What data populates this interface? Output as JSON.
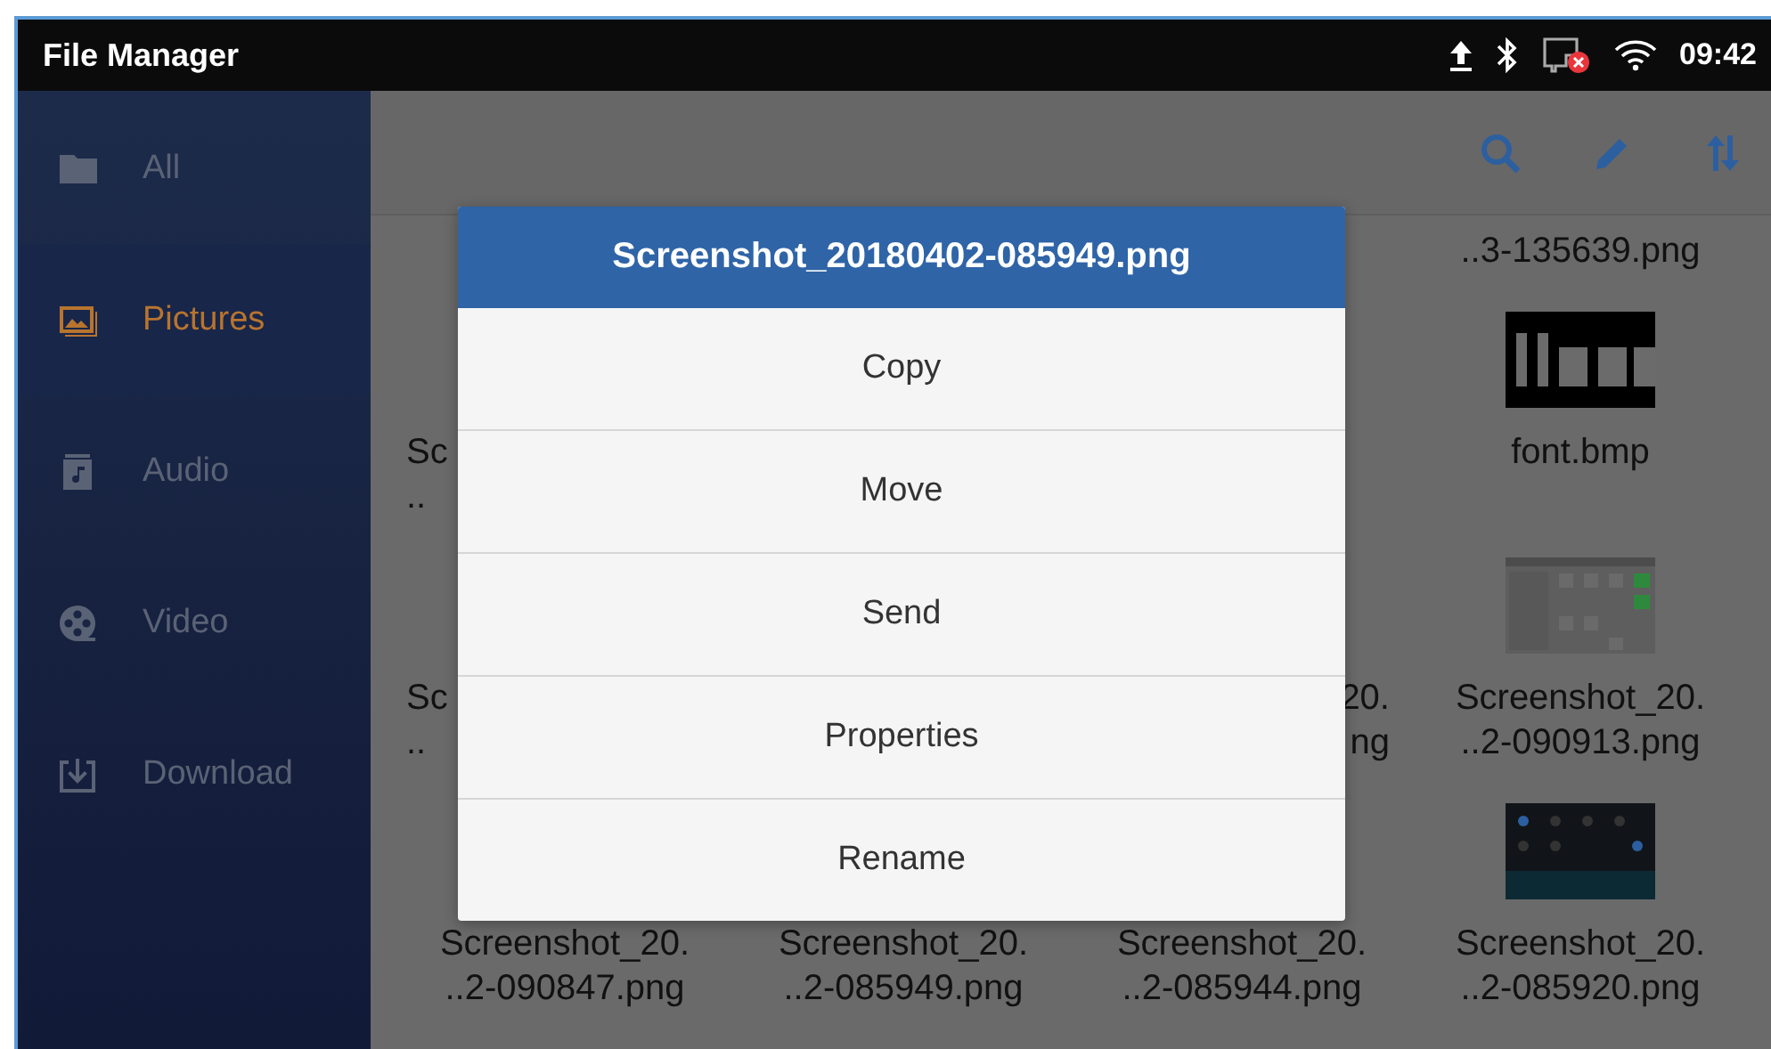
{
  "status_bar": {
    "title": "File Manager",
    "time": "09:42"
  },
  "sidebar": {
    "items": [
      {
        "label": "All",
        "selected": false
      },
      {
        "label": "Pictures",
        "selected": true
      },
      {
        "label": "Audio",
        "selected": false
      },
      {
        "label": "Video",
        "selected": false
      },
      {
        "label": "Download",
        "selected": false
      }
    ]
  },
  "grid": {
    "rows": [
      {
        "items": [
          {
            "kind": "covered"
          },
          {
            "kind": "covered"
          },
          {
            "kind": "covered"
          },
          {
            "kind": "file",
            "lines": [
              "..3-135639.png"
            ]
          }
        ]
      },
      {
        "items": [
          {
            "kind": "fragment",
            "covered_right": true,
            "lines": [
              "Sc",
              ".."
            ]
          },
          {
            "kind": "covered"
          },
          {
            "kind": "covered"
          },
          {
            "kind": "file",
            "thumb": {
              "kind": "picture"
            },
            "lines": [
              "font.bmp"
            ]
          }
        ]
      },
      {
        "items": [
          {
            "kind": "fragment",
            "covered_right": true,
            "lines": [
              "Sc",
              ".."
            ]
          },
          {
            "kind": "covered"
          },
          {
            "kind": "fragment",
            "covered_right": false,
            "lines": [
              "20.",
              "ng"
            ]
          },
          {
            "kind": "file",
            "thumb": {
              "kind": "picture"
            },
            "lines": [
              "Screenshot_20.",
              "..2-090913.png"
            ]
          }
        ]
      },
      {
        "items": [
          {
            "kind": "file",
            "lines": [
              "Screenshot_20.",
              "..2-090847.png"
            ]
          },
          {
            "kind": "file",
            "lines": [
              "Screenshot_20.",
              "..2-085949.png"
            ]
          },
          {
            "kind": "file",
            "lines": [
              "Screenshot_20.",
              "..2-085944.png"
            ]
          },
          {
            "kind": "file",
            "thumb": {
              "kind": "picture"
            },
            "lines": [
              "Screenshot_20.",
              "..2-085920.png"
            ]
          }
        ]
      }
    ]
  },
  "dialog": {
    "title": "Screenshot_20180402-085949.png",
    "options": [
      "Copy",
      "Move",
      "Send",
      "Properties",
      "Rename"
    ]
  }
}
